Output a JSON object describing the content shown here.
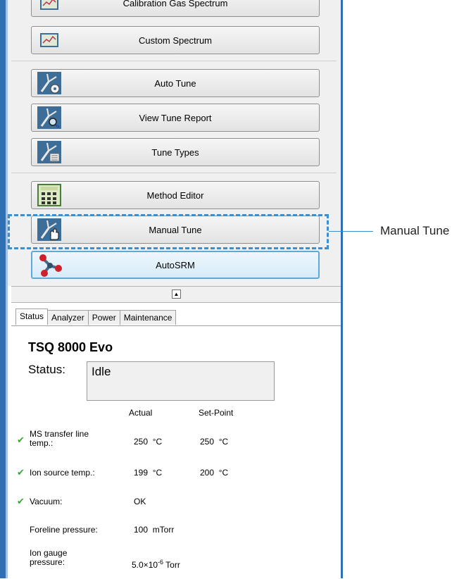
{
  "buttons": {
    "calibration": "Calibration Gas Spectrum",
    "custom": "Custom Spectrum",
    "auto_tune": "Auto Tune",
    "view_tune_report": "View Tune Report",
    "tune_types": "Tune Types",
    "method_editor": "Method Editor",
    "manual_tune": "Manual Tune",
    "autosrm": "AutoSRM"
  },
  "tabs": [
    "Status",
    "Analyzer",
    "Power",
    "Maintenance"
  ],
  "status_panel": {
    "instrument": "TSQ 8000 Evo",
    "status_label": "Status:",
    "status_value": "Idle",
    "col_actual": "Actual",
    "col_setpoint": "Set-Point",
    "rows": [
      {
        "label_line1": "MS transfer line",
        "label_line2": "temp.:",
        "actual": "250  °C",
        "setpoint": "250  °C"
      },
      {
        "label": "Ion source temp.:",
        "actual": "199  °C",
        "setpoint": "200  °C"
      },
      {
        "label": "Vacuum:",
        "actual": "OK"
      },
      {
        "label": "Foreline pressure:",
        "actual": "100  mTorr"
      },
      {
        "label_line1": "Ion gauge",
        "label_line2": "pressure:",
        "actual_base": "5.0×10",
        "actual_exp": "-6",
        "actual_unit": " Torr"
      }
    ]
  },
  "callout": "Manual Tune"
}
